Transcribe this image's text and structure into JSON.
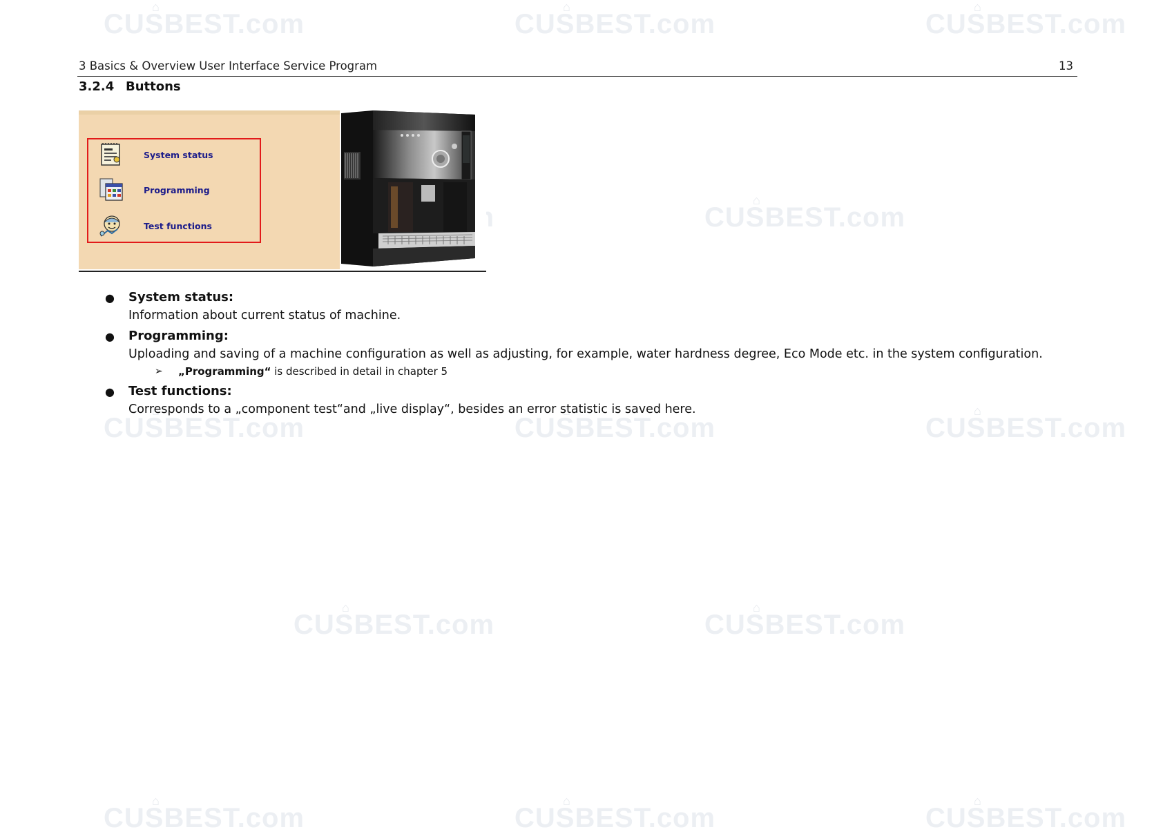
{
  "header": {
    "title": "3 Basics & Overview User Interface Service Program",
    "page_number": "13"
  },
  "section": {
    "number": "3.2.4",
    "title": "Buttons"
  },
  "figure": {
    "menu": [
      {
        "label": "System status",
        "icon": "notepad-icon"
      },
      {
        "label": "Programming",
        "icon": "spreadsheet-icon"
      },
      {
        "label": "Test functions",
        "icon": "technician-icon"
      }
    ],
    "image": "coffee-machine"
  },
  "bullets": [
    {
      "term": "System status:",
      "desc": "Information about current status of machine."
    },
    {
      "term": "Programming:",
      "desc": "Uploading and saving of a machine configuration as well as adjusting, for example, water hardness degree, Eco Mode etc. in the system configuration.",
      "sub": {
        "ref": "„Programming“",
        "text": " is described in detail in chapter 5"
      }
    },
    {
      "term": "Test functions:",
      "desc": "Corresponds to a „component test“and „live display“, besides an error statistic is saved here."
    }
  ],
  "watermark": "CUSBEST.com",
  "colors": {
    "panel_bg": "#f3d8b2",
    "highlight_border": "#e21a1a",
    "menu_text": "#1c1c8a"
  }
}
